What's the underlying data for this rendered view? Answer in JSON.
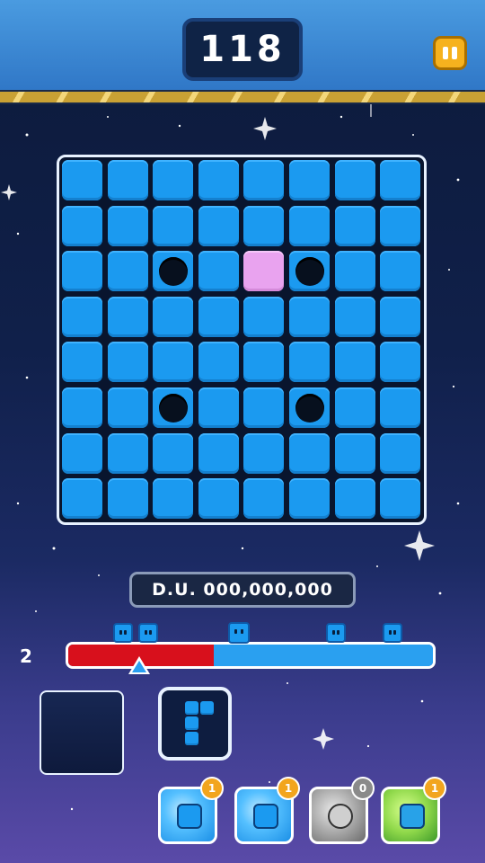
{
  "header": {
    "score": "118",
    "pause_icon": "pause-icon"
  },
  "board": {
    "rows": 8,
    "cols": 8,
    "holes": [
      [
        2,
        2
      ],
      [
        2,
        5
      ],
      [
        5,
        2
      ],
      [
        5,
        5
      ]
    ],
    "highlight": [
      [
        2,
        4
      ]
    ],
    "colors": {
      "cell": "#1b9af0",
      "highlight": "#e9a3ef",
      "hole": "#07101e"
    }
  },
  "distance": {
    "label": "D.U. 000,000,000"
  },
  "progress": {
    "level": "2",
    "fraction": 0.4,
    "colors": {
      "filled": "#d8101c",
      "remaining": "#2aa0f0"
    }
  },
  "tray": {
    "empty_slot_icon": "empty-slot",
    "active_piece_icon": "t-piece-icon"
  },
  "powerups": [
    {
      "name": "ice-cube-powerup",
      "count": "1",
      "icon": "ice-block-icon"
    },
    {
      "name": "freeze-blocks-powerup",
      "count": "1",
      "icon": "ice-cluster-icon"
    },
    {
      "name": "stone-monster-powerup",
      "count": "0",
      "icon": "stone-monster-icon"
    },
    {
      "name": "block-swarm-powerup",
      "count": "1",
      "icon": "block-swarm-icon"
    }
  ]
}
